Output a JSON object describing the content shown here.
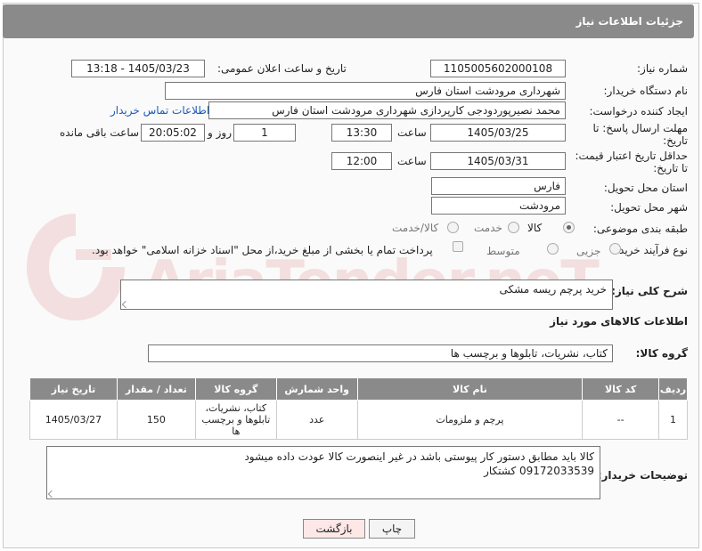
{
  "header": {
    "title": "جزئیات اطلاعات نیاز"
  },
  "form": {
    "need_number": {
      "label": "شماره نیاز:",
      "value": "1105005602000108"
    },
    "announce": {
      "label": "تاریخ و ساعت اعلان عمومی:",
      "value": "1405/03/23 - 13:18"
    },
    "buyer_org": {
      "label": "نام دستگاه خریدار:",
      "value": "شهرداری مرودشت استان فارس"
    },
    "creator": {
      "label": "ایجاد کننده درخواست:",
      "value": "محمد نصیرپوردودجی کارپردازی شهرداری مرودشت استان فارس",
      "contact_link": "اطلاعات تماس خریدار"
    },
    "reply_deadline": {
      "label_line1": "مهلت ارسال پاسخ: تا",
      "label_line2": "تاریخ:",
      "date": "1405/03/25",
      "time_label": "ساعت",
      "time": "13:30",
      "days": "1",
      "days_label": "روز و",
      "remaining": "20:05:02",
      "remaining_label": "ساعت باقی مانده"
    },
    "price_validity": {
      "label_line1": "حداقل تاریخ اعتبار قیمت:",
      "label_line2": "تا تاریخ:",
      "date": "1405/03/31",
      "time_label": "ساعت",
      "time": "12:00"
    },
    "delivery_province": {
      "label": "استان محل تحویل:",
      "value": "فارس"
    },
    "delivery_city": {
      "label": "شهر محل تحویل:",
      "value": "مرودشت"
    },
    "category": {
      "label": "طبقه بندی موضوعی:",
      "options": [
        "کالا",
        "خدمت",
        "کالا/خدمت"
      ],
      "selected": "کالا"
    },
    "process": {
      "label": "نوع فرآیند خرید :",
      "options": [
        "جزیی",
        "متوسط"
      ],
      "selected": "جزیی",
      "payment_note": "پرداخت تمام یا بخشی از مبلغ خرید،از محل \"اسناد خزانه اسلامی\" خواهد بود."
    }
  },
  "description": {
    "label": "شرح کلی نیاز:",
    "value": "خرید  پرچم ریسه مشکی"
  },
  "goods_section": {
    "title": "اطلاعات کالاهای مورد نیاز",
    "group_label": "گروه کالا:",
    "group_value": "کتاب، نشریات، تابلوها و برچسب ها",
    "columns": [
      "ردیف",
      "کد کالا",
      "نام کالا",
      "واحد شمارش",
      "گروه کالا",
      "تعداد / مقدار",
      "تاریخ نیاز"
    ],
    "rows": [
      {
        "row": "1",
        "code": "--",
        "name": "پرچم و ملزومات",
        "unit": "عدد",
        "group": "کتاب، نشریات، تابلوها و برچسب ها",
        "qty": "150",
        "date": "1405/03/27"
      }
    ]
  },
  "buyer_notes": {
    "label": "توضیحات خریدار:",
    "line1": "کالا باید مطابق دستور کار پیوستی باشد در غیر اینصورت کالا عودت داده میشود",
    "line2": "09172033539  کشتکار"
  },
  "buttons": {
    "print": "چاپ",
    "back": "بازگشت"
  },
  "watermark": {
    "text": "AriaTender.neT"
  },
  "colors": {
    "header_bg": "#8a8a8a",
    "link": "#1a5cb8",
    "back_button_bg": "#fde7e7",
    "watermark": "#c62828"
  }
}
